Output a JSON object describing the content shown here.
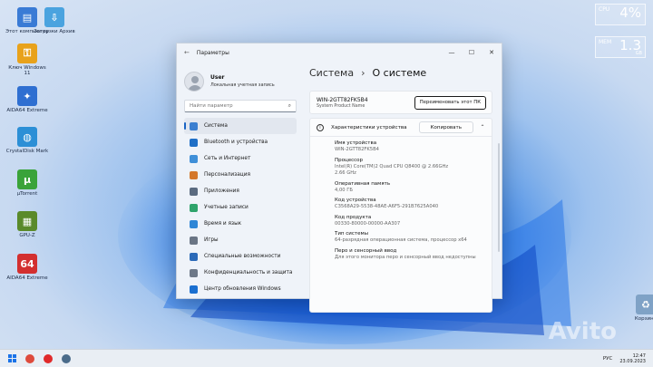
{
  "desktop": {
    "icons": [
      {
        "label": "Этот компьютер",
        "color": "#3a7bd5",
        "glyph": "▤"
      },
      {
        "label": "Загрузки Архив",
        "color": "#4aa3df",
        "glyph": "⇩"
      },
      {
        "label": "Ключ Windows 11",
        "color": "#e8a21b",
        "glyph": "⚿"
      },
      {
        "label": "AIDA64 Extreme",
        "color": "#2f6fd1",
        "glyph": "✦"
      },
      {
        "label": "CrystalDisk Mark",
        "color": "#2c8fd6",
        "glyph": "◍"
      },
      {
        "label": "µTorrent",
        "color": "#3aa33a",
        "glyph": "µ"
      },
      {
        "label": "GPU-Z",
        "color": "#5a8a2a",
        "glyph": "▦"
      },
      {
        "label": "AIDA64 Extreme",
        "color": "#d32f2f",
        "glyph": "64"
      },
      {
        "label": "Корзина",
        "color": "#7fa2c6",
        "glyph": "♻"
      }
    ],
    "gadgets": {
      "cpu_label": "CPU",
      "cpu_value": "4%",
      "mem_label": "MEM",
      "mem_value": "1.3",
      "mem_unit": "GB"
    }
  },
  "window": {
    "title": "Параметры",
    "controls": [
      "—",
      "☐",
      "✕"
    ],
    "user": {
      "name": "User",
      "subtitle": "Локальная учетная запись"
    },
    "search_placeholder": "Найти параметр",
    "nav": [
      {
        "label": "Система",
        "color": "#3b7fd0",
        "active": true
      },
      {
        "label": "Bluetooth и устройства",
        "color": "#1f6fc6",
        "active": false
      },
      {
        "label": "Сеть и Интернет",
        "color": "#3f8fd8",
        "active": false
      },
      {
        "label": "Персонализация",
        "color": "#d4782b",
        "active": false
      },
      {
        "label": "Приложения",
        "color": "#5b6b80",
        "active": false
      },
      {
        "label": "Учетные записи",
        "color": "#2fa36b",
        "active": false
      },
      {
        "label": "Время и язык",
        "color": "#2f86d6",
        "active": false
      },
      {
        "label": "Игры",
        "color": "#6a7585",
        "active": false
      },
      {
        "label": "Специальные возможности",
        "color": "#2b6ab8",
        "active": false
      },
      {
        "label": "Конфиденциальность и защита",
        "color": "#6d7888",
        "active": false
      },
      {
        "label": "Центр обновления Windows",
        "color": "#1a6fd0",
        "active": false
      }
    ],
    "breadcrumb": {
      "parent": "Система",
      "separator": "›",
      "current": "О системе"
    },
    "pc": {
      "name": "WIN-2GTT82FK5B4",
      "product": "System Product Name",
      "rename_label": "Переименовать этот ПК"
    },
    "specs": {
      "header": "Характеристики устройства",
      "copy_label": "Копировать",
      "items": [
        {
          "key": "Имя устройства",
          "value": "WIN-2GTT82FK5B4"
        },
        {
          "key": "Процессор",
          "value": "Intel(R) Core(TM)2 Quad CPU    Q8400  @ 2.66GHz",
          "value2": "2.66 GHz"
        },
        {
          "key": "Оперативная память",
          "value": "4,00 ГБ"
        },
        {
          "key": "Код устройства",
          "value": "C3568A29-5538-48AE-A6F5-291B7625A040"
        },
        {
          "key": "Код продукта",
          "value": "00330-80000-00000-AA307"
        },
        {
          "key": "Тип системы",
          "value": "64-разрядная операционная система, процессор x64"
        },
        {
          "key": "Перо и сенсорный ввод",
          "value": "Для этого монитора перо и сенсорный ввод недоступны"
        }
      ]
    }
  },
  "taskbar": {
    "apps": [
      {
        "name": "chrome",
        "color": "#de4b3c"
      },
      {
        "name": "yandex",
        "color": "#e02a2a"
      },
      {
        "name": "settings",
        "color": "#4a6b8a"
      }
    ],
    "lang": "РУС",
    "time": "12:47",
    "date": "23.09.2023"
  },
  "watermark": "Avito"
}
